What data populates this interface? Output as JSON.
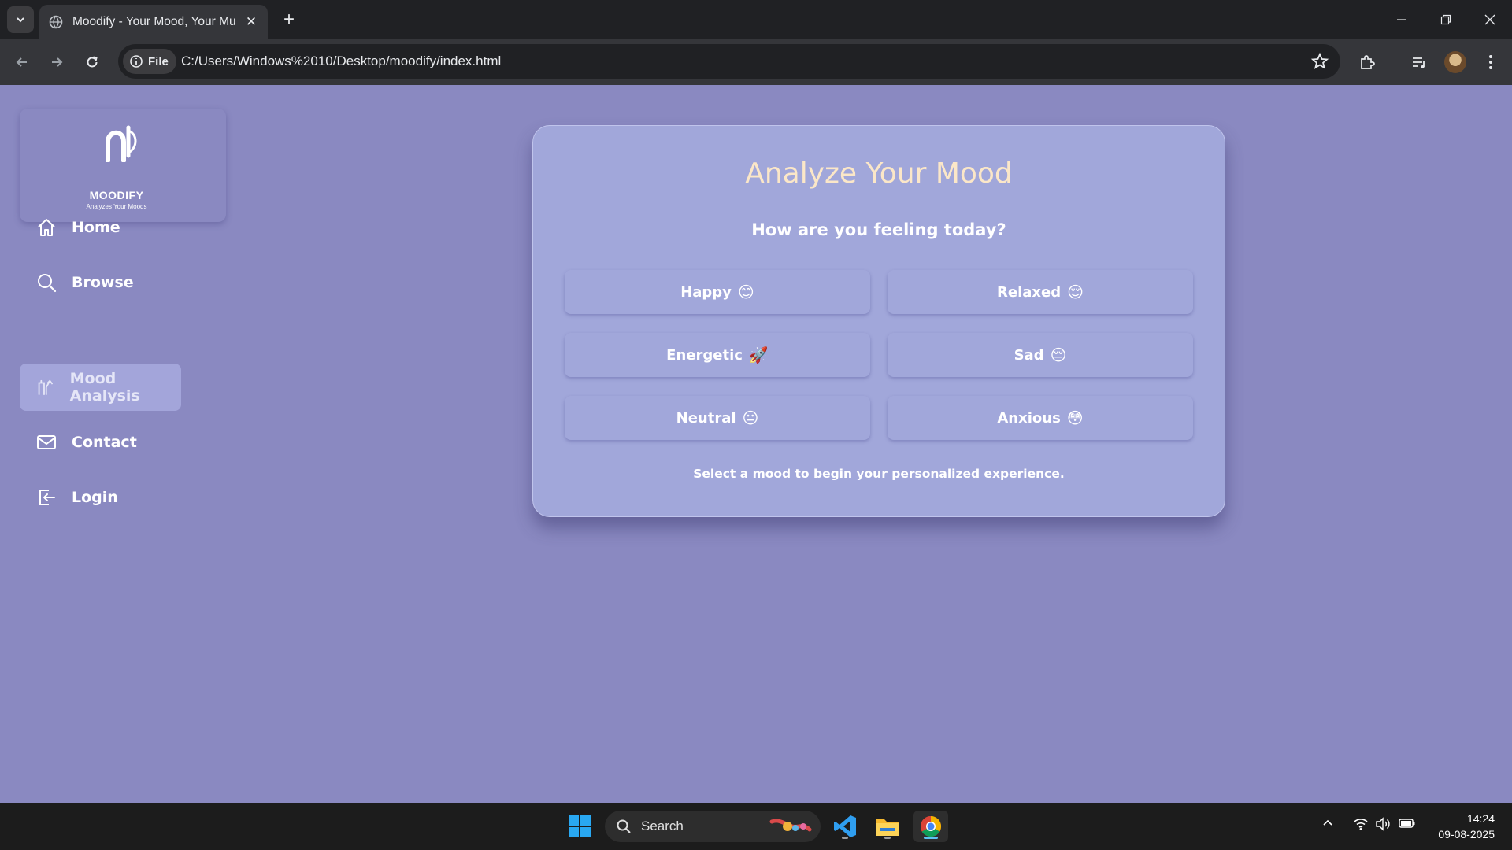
{
  "browser": {
    "tab_title": "Moodify - Your Mood, Your Mu",
    "site_chip": "File",
    "url": "C:/Users/Windows%2010/Desktop/moodify/index.html"
  },
  "sidebar": {
    "logo_name": "MOODIFY",
    "logo_tagline": "Analyzes Your Moods",
    "items": [
      {
        "label": "Home",
        "icon": "home-icon"
      },
      {
        "label": "Browse",
        "icon": "search-icon"
      },
      {
        "label": "Mood Analysis",
        "icon": "mood-analysis-icon",
        "active": true
      },
      {
        "label": "Contact",
        "icon": "mail-icon"
      },
      {
        "label": "Login",
        "icon": "login-icon"
      }
    ]
  },
  "main": {
    "title": "Analyze Your Mood",
    "subtitle": "How are you feeling today?",
    "moods": [
      {
        "label": "Happy",
        "emoji": "😊"
      },
      {
        "label": "Relaxed",
        "emoji": "😌"
      },
      {
        "label": "Energetic",
        "emoji": "🚀"
      },
      {
        "label": "Sad",
        "emoji": "😔"
      },
      {
        "label": "Neutral",
        "emoji": "😐"
      },
      {
        "label": "Anxious",
        "emoji": "😳"
      }
    ],
    "footer": "Select a mood to begin your personalized experience."
  },
  "taskbar": {
    "search_label": "Search",
    "time": "14:24",
    "date": "09-08-2025"
  },
  "colors": {
    "page_bg": "#8a89c1",
    "card_bg": "#a1a7da",
    "title": "#fbe7c8",
    "active_nav": "#a3a5da"
  }
}
